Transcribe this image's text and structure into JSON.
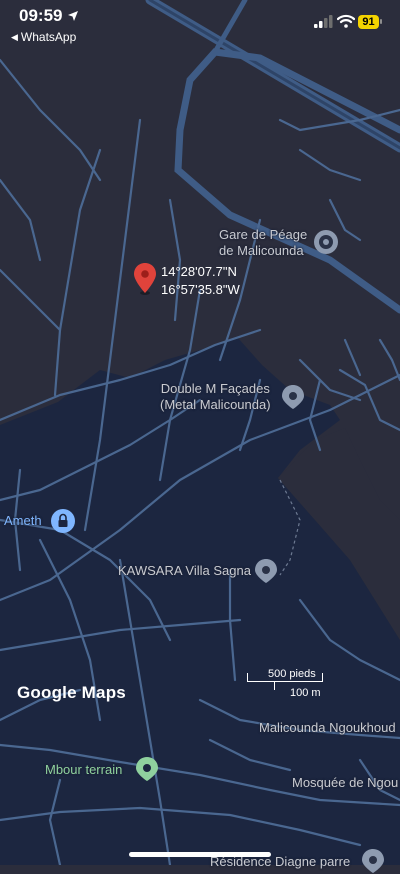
{
  "status_bar": {
    "time": "09:59",
    "back_label": "WhatsApp",
    "battery": "91"
  },
  "map": {
    "dropped_pin": {
      "lat": "14°28'07.7\"N",
      "lng": "16°57'35.8\"W"
    },
    "places": [
      {
        "line1": "Gare de Péage",
        "line2": "de Malicounda",
        "icon": "transit-pin-icon"
      },
      {
        "line1": "Double M Façades",
        "line2": "(Metal Malicounda)",
        "icon": "place-pin-icon"
      },
      {
        "line1": "Ameth",
        "icon": "lock-pin-icon"
      },
      {
        "line1": "KAWSARA Villa Sagna",
        "icon": "place-pin-icon"
      },
      {
        "line1": "Mbour terrain",
        "icon": "green-place-pin-icon"
      },
      {
        "line1": "Malicounda Ngoukhoud"
      },
      {
        "line1": "Mosquée de Ngou"
      },
      {
        "line1": "Résidence Diagne parre",
        "icon": "place-pin-icon"
      }
    ],
    "scale": {
      "top": "500 pieds",
      "bottom": "100 m"
    },
    "brand": "Google Maps",
    "colors": {
      "land": "#2b2d3c",
      "urban": "#1c2640",
      "road": "#4a6790",
      "highway": "#3f5c86",
      "pin": "#e0433b"
    }
  }
}
